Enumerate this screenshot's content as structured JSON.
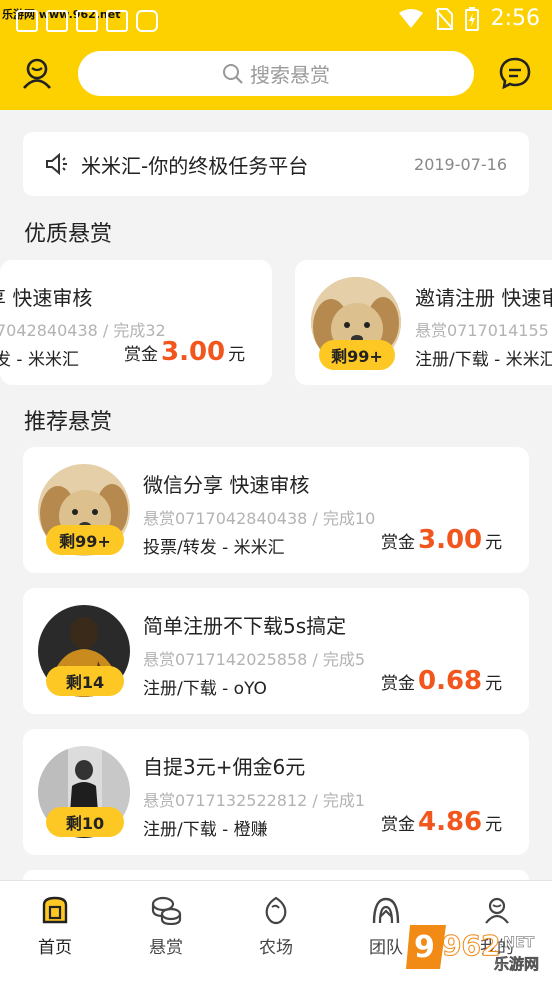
{
  "status_bar": {
    "watermark": "乐游网 www.962.net",
    "time": "2:56"
  },
  "header": {
    "search_placeholder": "搜索悬赏",
    "left_icon": "user-icon",
    "right_icon": "message-icon"
  },
  "notice": {
    "text": "米米汇-你的终极任务平台",
    "date": "2019-07-16"
  },
  "sections": {
    "featured_title": "优质悬赏",
    "recommended_title": "推荐悬赏"
  },
  "featured": [
    {
      "title": "享 快速审核",
      "id_line": "7042840438 / 完成32",
      "category": "发 - 米米汇",
      "reward_label": "赏金",
      "amount": "3.00",
      "unit": "元"
    },
    {
      "title": "邀请注册 快速审",
      "id_line": "悬赏0717014155",
      "category": "注册/下载 - 米米汇",
      "badge": "剩99+"
    }
  ],
  "tasks": [
    {
      "title": "微信分享 快速审核",
      "id_line": "悬赏0717042840438 / 完成10",
      "category": "投票/转发 - 米米汇",
      "reward_label": "赏金",
      "amount": "3.00",
      "unit": "元",
      "badge": "剩99+"
    },
    {
      "title": "简单注册不下载5s搞定",
      "id_line": "悬赏0717142025858 / 完成5",
      "category": "注册/下载 - oYO",
      "reward_label": "赏金",
      "amount": "0.68",
      "unit": "元",
      "badge": "剩14"
    },
    {
      "title": "自提3元+佣金6元",
      "id_line": "悬赏0717132522812 / 完成1",
      "category": "注册/下载 - 橙赚",
      "reward_label": "赏金",
      "amount": "4.86",
      "unit": "元",
      "badge": "剩10"
    }
  ],
  "tabs": [
    {
      "label": "首页",
      "icon": "home-icon"
    },
    {
      "label": "悬赏",
      "icon": "coins-icon"
    },
    {
      "label": "农场",
      "icon": "seed-icon"
    },
    {
      "label": "团队",
      "icon": "team-icon"
    },
    {
      "label": "我的",
      "icon": "profile-icon"
    }
  ],
  "watermark_bottom": {
    "brand": "962",
    "domain": ".NET",
    "site": "乐游网"
  },
  "colors": {
    "brand": "#fdd000",
    "price": "#f2561d",
    "badge": "#fdc823"
  }
}
